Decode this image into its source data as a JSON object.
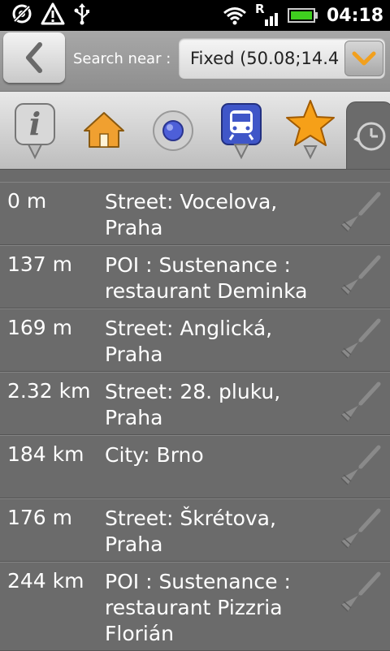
{
  "status_bar": {
    "time": "04:18",
    "left_icons": [
      "gps-icon",
      "warning-icon",
      "usb-icon"
    ],
    "right_icons": [
      "wifi-icon",
      "signal-roaming-icon",
      "battery-icon"
    ],
    "roaming_label": "R"
  },
  "search": {
    "back_icon": "chevron-left-icon",
    "label": "Search near :",
    "location_value": "Fixed (50.08;14.4",
    "dropdown_icon": "chevron-down-icon",
    "accent_color": "#f2a01e"
  },
  "tabs": [
    {
      "icon": "info-icon",
      "active": false
    },
    {
      "icon": "home-icon",
      "active": false
    },
    {
      "icon": "current-position-icon",
      "active": false
    },
    {
      "icon": "transport-icon",
      "active": false
    },
    {
      "icon": "favorite-star-icon",
      "active": false
    },
    {
      "icon": "history-clock-icon",
      "active": true
    }
  ],
  "results": [
    {
      "distance": "0 m",
      "description": "Street: Vocelova, Praha",
      "action_icon": "broom-icon"
    },
    {
      "distance": "137 m",
      "description": "POI : Sustenance : restaurant Deminka",
      "action_icon": "broom-icon"
    },
    {
      "distance": "169 m",
      "description": "Street: Anglická, Praha",
      "action_icon": "broom-icon"
    },
    {
      "distance": "2.32 km",
      "description": "Street: 28. pluku, Praha",
      "action_icon": "broom-icon"
    },
    {
      "distance": "184 km",
      "description": "City: Brno",
      "action_icon": "broom-icon"
    },
    {
      "distance": "176 m",
      "description": "Street: Škrétova, Praha",
      "action_icon": "broom-icon"
    },
    {
      "distance": "244 km",
      "description": "POI : Sustenance : restaurant Pizzria Florián",
      "action_icon": "broom-icon"
    }
  ]
}
